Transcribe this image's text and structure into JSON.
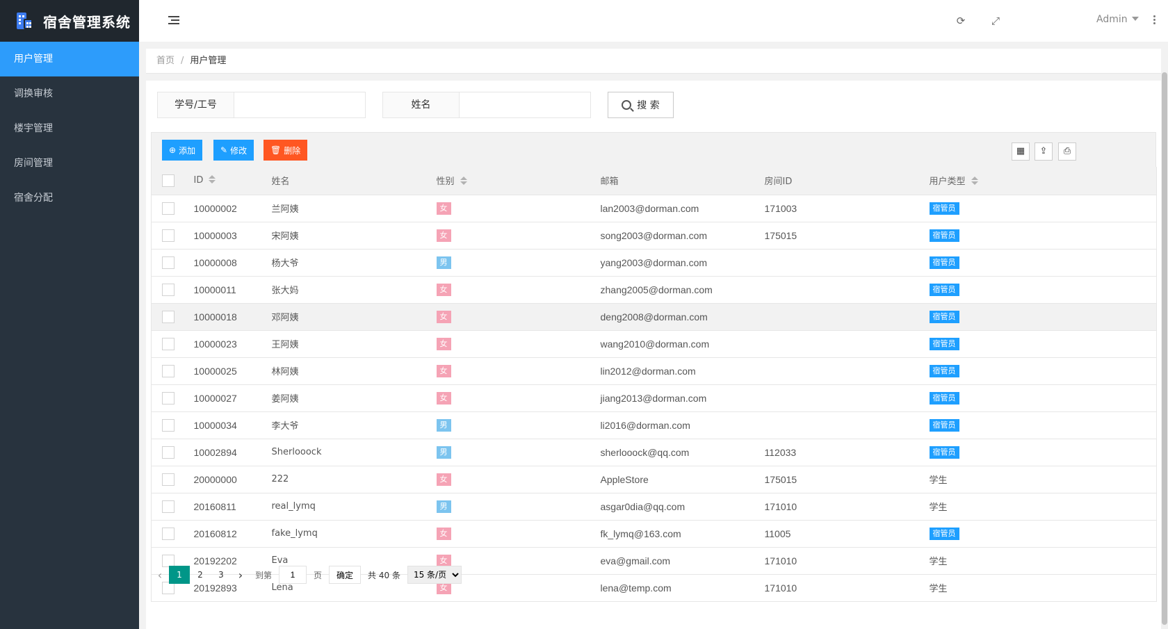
{
  "app": {
    "title": "宿舍管理系统"
  },
  "sidebar": {
    "items": [
      {
        "label": "用户管理",
        "active": true
      },
      {
        "label": "调换审核"
      },
      {
        "label": "楼宇管理"
      },
      {
        "label": "房间管理"
      },
      {
        "label": "宿舍分配"
      }
    ]
  },
  "header": {
    "user": "Admin",
    "icons": [
      "refresh-icon",
      "fullscreen-icon",
      "more-icon"
    ]
  },
  "breadcrumb": {
    "home": "首页",
    "separator": "/",
    "current": "用户管理"
  },
  "search": {
    "id_label": "学号/工号",
    "id_value": "",
    "name_label": "姓名",
    "name_value": "",
    "button": "搜 索"
  },
  "toolbar": {
    "add": "添加",
    "edit": "修改",
    "delete": "删除"
  },
  "colors": {
    "primary": "#1e9fff",
    "danger": "#ff5722",
    "female": "#f5a3b5",
    "male": "#7cc4ef",
    "page_active": "#009688",
    "sidebar": "#28333e"
  },
  "table": {
    "headers": [
      "ID",
      "姓名",
      "性别",
      "邮箱",
      "房间ID",
      "用户类型"
    ],
    "rows": [
      {
        "id": "10000002",
        "name": "兰阿姨",
        "gender": "女",
        "email": "lan2003@dorman.com",
        "room": "171003",
        "type": "宿管员"
      },
      {
        "id": "10000003",
        "name": "宋阿姨",
        "gender": "女",
        "email": "song2003@dorman.com",
        "room": "175015",
        "type": "宿管员"
      },
      {
        "id": "10000008",
        "name": "杨大爷",
        "gender": "男",
        "email": "yang2003@dorman.com",
        "room": "",
        "type": "宿管员"
      },
      {
        "id": "10000011",
        "name": "张大妈",
        "gender": "女",
        "email": "zhang2005@dorman.com",
        "room": "",
        "type": "宿管员"
      },
      {
        "id": "10000018",
        "name": "邓阿姨",
        "gender": "女",
        "email": "deng2008@dorman.com",
        "room": "",
        "type": "宿管员"
      },
      {
        "id": "10000023",
        "name": "王阿姨",
        "gender": "女",
        "email": "wang2010@dorman.com",
        "room": "",
        "type": "宿管员"
      },
      {
        "id": "10000025",
        "name": "林阿姨",
        "gender": "女",
        "email": "lin2012@dorman.com",
        "room": "",
        "type": "宿管员"
      },
      {
        "id": "10000027",
        "name": "姜阿姨",
        "gender": "女",
        "email": "jiang2013@dorman.com",
        "room": "",
        "type": "宿管员"
      },
      {
        "id": "10000034",
        "name": "李大爷",
        "gender": "男",
        "email": "li2016@dorman.com",
        "room": "",
        "type": "宿管员"
      },
      {
        "id": "10002894",
        "name": "Sherlooock",
        "gender": "男",
        "email": "sherlooock@qq.com",
        "room": "112033",
        "type": "宿管员"
      },
      {
        "id": "20000000",
        "name": "222",
        "gender": "女",
        "email": "AppleStore",
        "room": "175015",
        "type": "学生"
      },
      {
        "id": "20160811",
        "name": "real_lymq",
        "gender": "男",
        "email": "asgar0dia@qq.com",
        "room": "171010",
        "type": "学生"
      },
      {
        "id": "20160812",
        "name": "fake_lymq",
        "gender": "女",
        "email": "fk_lymq@163.com",
        "room": "11005",
        "type": "宿管员"
      },
      {
        "id": "20192202",
        "name": "Eva",
        "gender": "女",
        "email": "eva@gmail.com",
        "room": "171010",
        "type": "学生"
      },
      {
        "id": "20192893",
        "name": "Lena",
        "gender": "女",
        "email": "lena@temp.com",
        "room": "171010",
        "type": "学生"
      }
    ]
  },
  "pagination": {
    "pages": [
      "1",
      "2",
      "3"
    ],
    "current": "1",
    "goto_label": "到第",
    "goto_value": "1",
    "page_unit": "页",
    "confirm": "确定",
    "total": "共 40 条",
    "page_size": "15 条/页"
  }
}
